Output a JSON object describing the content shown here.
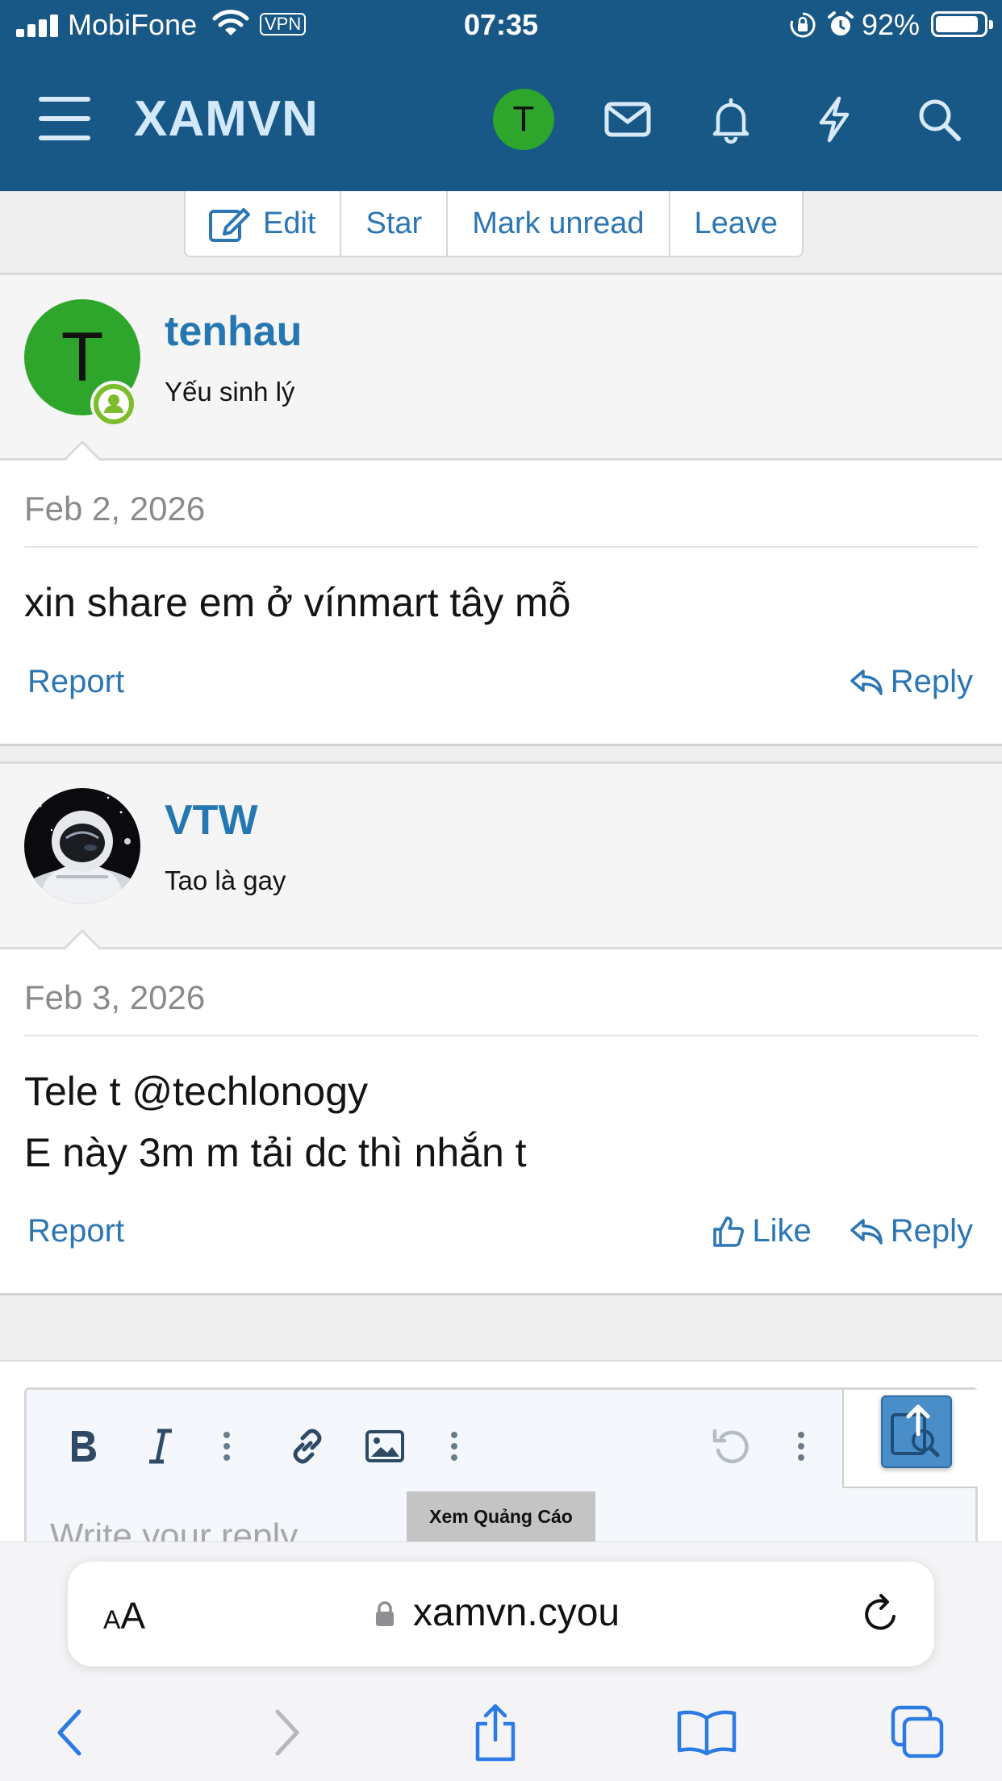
{
  "status_bar": {
    "carrier": "MobiFone",
    "vpn_label": "VPN",
    "time": "07:35",
    "battery_percent": "92%",
    "battery_level": 0.92,
    "icons": [
      "signal-icon",
      "wifi-icon",
      "orientation-lock-icon",
      "alarm-icon",
      "battery-icon"
    ]
  },
  "header": {
    "menu_icon": "hamburger-icon",
    "logo": "XAMVN",
    "avatar_letter": "T",
    "avatar_color": "#2ea62b",
    "icons": [
      "mail-icon",
      "bell-icon",
      "bolt-icon",
      "search-icon"
    ],
    "background": "#185886"
  },
  "thread_actions": {
    "edit": "Edit",
    "star": "Star",
    "mark_unread": "Mark unread",
    "leave": "Leave"
  },
  "posts": [
    {
      "username": "tenhau",
      "user_title": "Yếu sinh lý",
      "avatar_letter": "T",
      "avatar_color": "#2ea62b",
      "online": true,
      "date": "Feb 2, 2026",
      "text_lines": [
        "xin share em ở vínmart tây mỗ"
      ],
      "report": "Report",
      "reply": "Reply"
    },
    {
      "username": "VTW",
      "user_title": "Tao là gay",
      "avatar_icon": "astronaut-avatar",
      "date": "Feb 3, 2026",
      "text_lines": [
        "Tele t @techlonogy",
        "E này 3m m tải dc thì nhắn t"
      ],
      "report": "Report",
      "like": "Like",
      "reply": "Reply"
    }
  ],
  "editor": {
    "tools": [
      "bold-icon",
      "italic-icon",
      "more-vertical-icon",
      "link-icon",
      "image-icon",
      "more-vertical-icon",
      "undo-icon",
      "more-vertical-icon"
    ],
    "placeholder": "Write your reply...",
    "ad_label": "Xem Quảng Cáo",
    "upload_icon": "upload-icon"
  },
  "safari": {
    "text_size": "AA",
    "url": "xamvn.cyou",
    "icons": [
      "back-icon",
      "forward-icon",
      "share-icon",
      "bookmarks-icon",
      "tabs-icon",
      "reload-icon",
      "lock-icon"
    ]
  }
}
